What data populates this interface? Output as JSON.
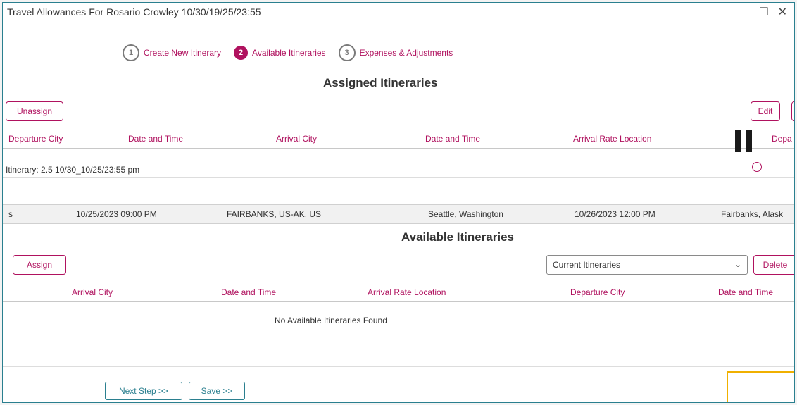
{
  "window": {
    "title": "Travel Allowances For Rosario Crowley 10/30/19/25/23:55",
    "minimize": "☐",
    "close": "✕"
  },
  "steps": [
    {
      "num": "1",
      "label": "Create New Itinerary"
    },
    {
      "num": "2",
      "label": "Available Itineraries"
    },
    {
      "num": "3",
      "label": "Expenses & Adjustments"
    }
  ],
  "assigned": {
    "title": "Assigned Itineraries",
    "unassign_label": "Unassign",
    "edit_label": "Edit",
    "columns": [
      "Departure City",
      "Date and Time",
      "Arrival City",
      "Date and Time",
      "Arrival Rate Location",
      "Depa"
    ],
    "group_row": "Itinerary: 2.5 10/30_10/25/23:55 pm",
    "row": {
      "c1": "s",
      "c2": "10/25/2023 09:00 PM",
      "c3": "FAIRBANKS, US-AK, US",
      "c4": "Seattle, Washington",
      "c5": "10/26/2023 12:00 PM",
      "c6": "Fairbanks, Alask"
    }
  },
  "available": {
    "title": "Available Itineraries",
    "assign_label": "Assign",
    "select_value": "Current Itineraries",
    "select_icon": "chevron-down",
    "delete_label": "Delete",
    "columns": [
      "Arrival City",
      "Date and Time",
      "Arrival Rate Location",
      "Departure City",
      "Date and Time"
    ],
    "empty_message": "No Available Itineraries Found"
  },
  "footer": {
    "next_label": "Next Step >>",
    "save_label": "Save >>"
  },
  "colors": {
    "accent": "#b0125f",
    "border": "#2a7f8f",
    "focus": "#f0b000"
  }
}
